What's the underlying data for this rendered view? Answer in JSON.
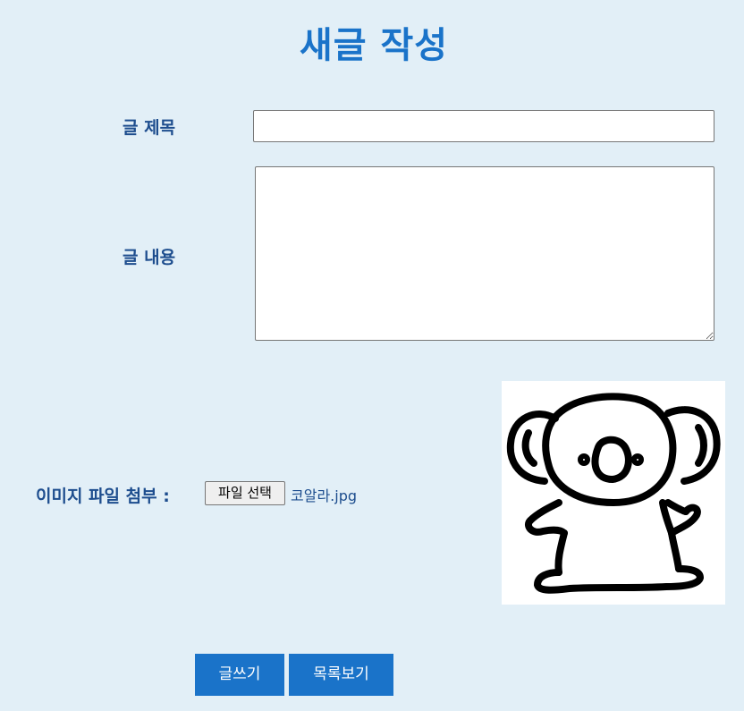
{
  "page": {
    "title": "새글 작성"
  },
  "form": {
    "title_label": "글 제목",
    "title_value": "",
    "content_label": "글 내용",
    "content_value": "",
    "file_label": "이미지 파일 첨부 :",
    "file_button_label": "파일 선택",
    "file_name": "코알라.jpg"
  },
  "preview": {
    "icon": "koala-drawing"
  },
  "actions": {
    "write_label": "글쓰기",
    "list_label": "목록보기"
  },
  "colors": {
    "background": "#e2eff7",
    "accent": "#1a73c9",
    "label": "#1d4d8e"
  }
}
